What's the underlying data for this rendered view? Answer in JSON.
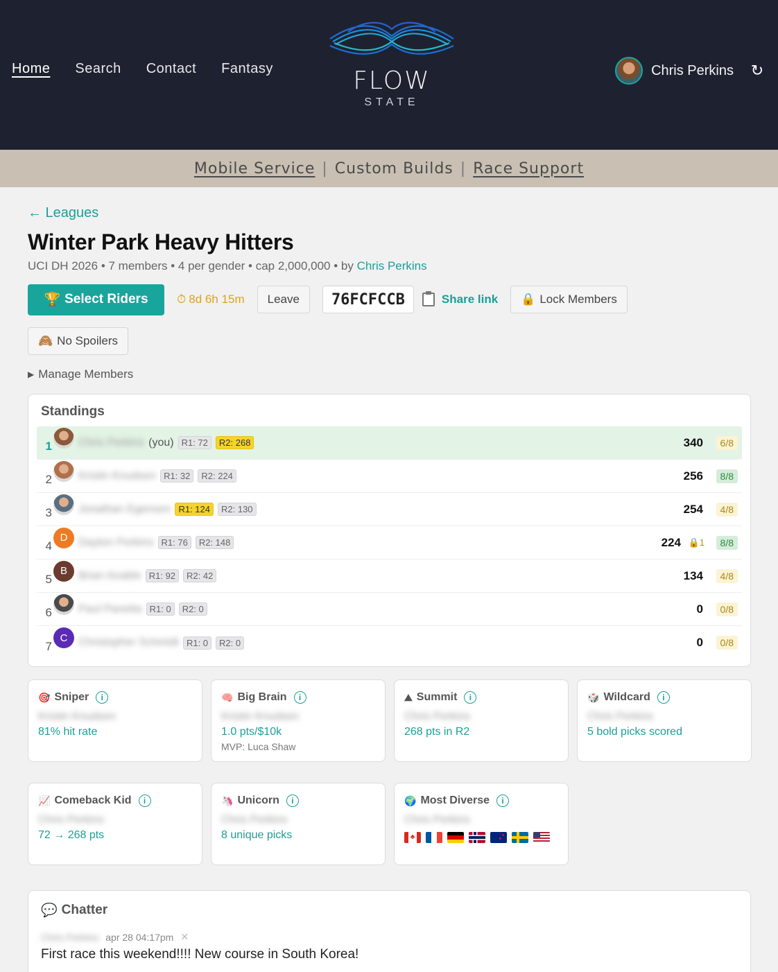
{
  "nav": {
    "home": "Home",
    "search": "Search",
    "contact": "Contact",
    "fantasy": "Fantasy"
  },
  "logo": {
    "line1": "FLOW",
    "line2": "STATE"
  },
  "user": {
    "name": "Chris Perkins"
  },
  "banner": {
    "mobile": "Mobile Service",
    "custom": "Custom Builds",
    "race": "Race Support",
    "sep": "|"
  },
  "league": {
    "back": "← Leagues",
    "title": "Winter Park Heavy Hitters",
    "meta": "UCI DH 2026 • 7 members • 4 per gender • cap 2,000,000 • by ",
    "creator": "Chris Perkins"
  },
  "actions": {
    "select": "Select Riders",
    "timer": "8d 6h 15m",
    "leave": "Leave",
    "code": "76FCFCCB",
    "share": "Share link",
    "lock": "Lock Members",
    "spoilers": "No Spoilers",
    "manage": "Manage Members"
  },
  "standings": {
    "title": "Standings",
    "rows": [
      {
        "rank": "1",
        "name": "Chris Perkins",
        "you": "(you)",
        "r1": "R1: 72",
        "r2": "R2: 268",
        "points": "340",
        "ratio": "6/8",
        "avatar": "photo",
        "color": "#8a5a3a"
      },
      {
        "rank": "2",
        "name": "Kristin Knudsen",
        "r1": "R1: 32",
        "r2": "R2: 224",
        "points": "256",
        "ratio": "8/8",
        "avatar": "photo",
        "color": "#b0704a"
      },
      {
        "rank": "3",
        "name": "Jonathan Egensen",
        "r1": "R1: 124",
        "r2": "R2: 130",
        "points": "254",
        "ratio": "4/8",
        "avatar": "photo",
        "color": "#5a6e80"
      },
      {
        "rank": "4",
        "name": "Dayton Perkins",
        "r1": "R1: 76",
        "r2": "R2: 148",
        "points": "224",
        "lock": "1",
        "ratio": "8/8",
        "avatar": "D",
        "color": "#ee7b22"
      },
      {
        "rank": "5",
        "name": "Brian Anable",
        "r1": "R1: 92",
        "r2": "R2: 42",
        "points": "134",
        "ratio": "4/8",
        "avatar": "B",
        "color": "#6b3b2e"
      },
      {
        "rank": "6",
        "name": "Paul Panetta",
        "r1": "R1: 0",
        "r2": "R2: 0",
        "points": "0",
        "ratio": "0/8",
        "avatar": "photo",
        "color": "#4a4a4a"
      },
      {
        "rank": "7",
        "name": "Christopher Schmidt",
        "r1": "R1: 0",
        "r2": "R2: 0",
        "points": "0",
        "ratio": "0/8",
        "avatar": "C",
        "color": "#5b2bb5"
      }
    ]
  },
  "awards": {
    "sniper": {
      "title": "Sniper",
      "winner": "Kristin Knudsen",
      "stat": "81% hit rate"
    },
    "bigbrain": {
      "title": "Big Brain",
      "winner": "Kristin Knudsen",
      "stat": "1.0 pts/$10k",
      "sub": "MVP: Luca Shaw"
    },
    "summit": {
      "title": "Summit",
      "winner": "Chris Perkins",
      "stat": "268 pts in R2"
    },
    "wildcard": {
      "title": "Wildcard",
      "winner": "Chris Perkins",
      "stat": "5 bold picks scored"
    },
    "comeback": {
      "title": "Comeback Kid",
      "winner": "Chris Perkins",
      "stat": "72 → 268 pts"
    },
    "unicorn": {
      "title": "Unicorn",
      "winner": "Chris Perkins",
      "stat": "8 unique picks"
    },
    "diverse": {
      "title": "Most Diverse",
      "winner": "Chris Perkins"
    }
  },
  "chatter": {
    "title": "Chatter",
    "author": "Chris Perkins",
    "time": "apr 28 04:17pm",
    "text": "First race this weekend!!!! New course in South Korea!"
  },
  "colors": {
    "accent": "#1aa59c",
    "header": "#1e2230",
    "banner": "#c9bfb2",
    "highlight": "#f6d32a"
  }
}
